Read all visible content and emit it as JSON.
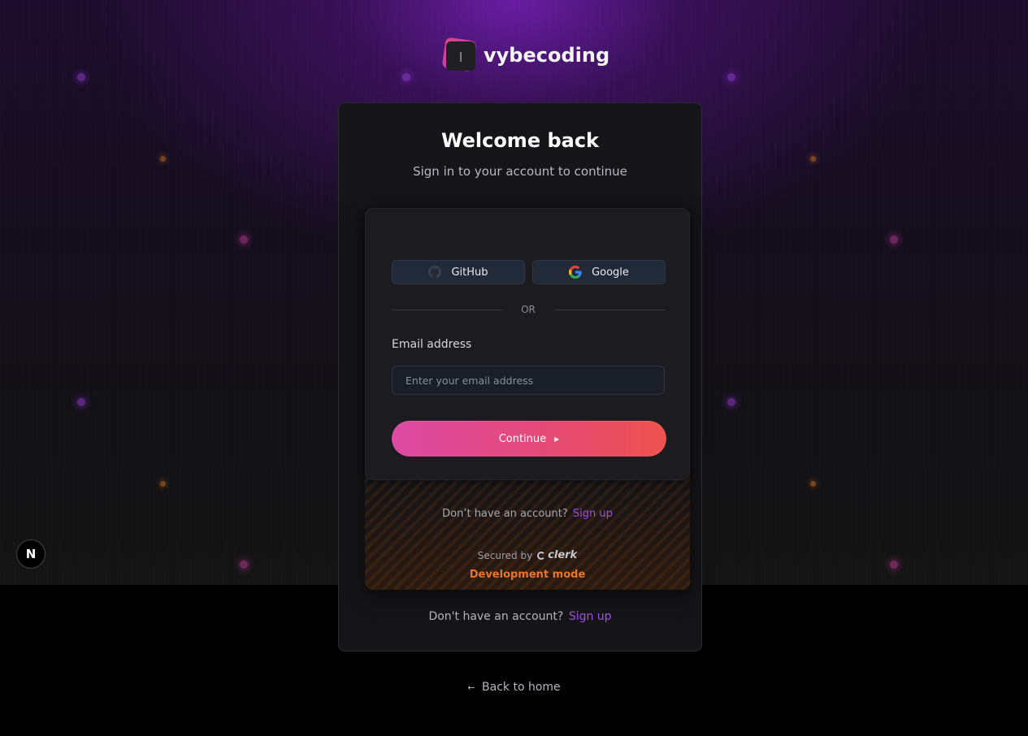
{
  "brand": {
    "name": "vybecoding",
    "logo_icon": "vybecoding-logo-icon"
  },
  "card": {
    "title": "Welcome back",
    "subtitle": "Sign in to your account to continue",
    "signup_prompt": "Don't have an account?",
    "signup_link": "Sign up"
  },
  "clerk": {
    "social_buttons": [
      {
        "label": "GitHub",
        "icon": "github-icon"
      },
      {
        "label": "Google",
        "icon": "google-icon"
      }
    ],
    "divider": "OR",
    "email_label": "Email address",
    "email_placeholder": "Enter your email address",
    "email_value": "",
    "continue_label": "Continue",
    "signup_prompt": "Don’t have an account?",
    "signup_link": "Sign up",
    "secured_by": "Secured by",
    "provider": "clerk",
    "dev_mode": "Development mode"
  },
  "footer": {
    "back_home": "Back to home",
    "back_arrow": "←"
  },
  "next_badge": "N",
  "colors": {
    "accent_purple": "#a24fe6",
    "continue_gradient_start": "#dc4aa4",
    "continue_gradient_end": "#ee524e",
    "dev_mode_orange": "#e8762a",
    "card_bg": "#161619"
  }
}
